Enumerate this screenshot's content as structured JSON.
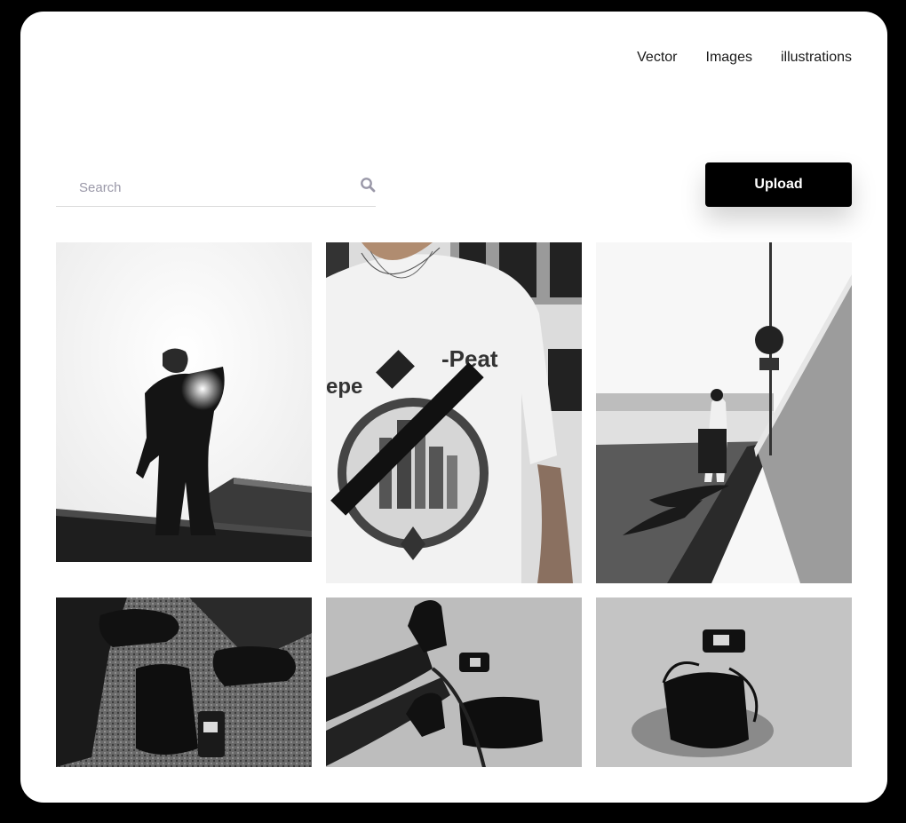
{
  "nav": {
    "items": [
      {
        "label": "Vector"
      },
      {
        "label": "Images"
      },
      {
        "label": "illustrations"
      }
    ]
  },
  "search": {
    "placeholder": "Search",
    "value": "",
    "icon": "search-icon"
  },
  "upload": {
    "label": "Upload"
  },
  "gallery": {
    "photos": [
      {
        "subject": "man-silhouette-pointing"
      },
      {
        "subject": "graphic-tshirt-crossbody-bag"
      },
      {
        "subject": "man-walking-by-wall"
      },
      {
        "subject": "boots-bag-camera-gravel"
      },
      {
        "subject": "legs-boots-bag-camera-pavement"
      },
      {
        "subject": "bag-and-camera-pavement"
      }
    ]
  }
}
